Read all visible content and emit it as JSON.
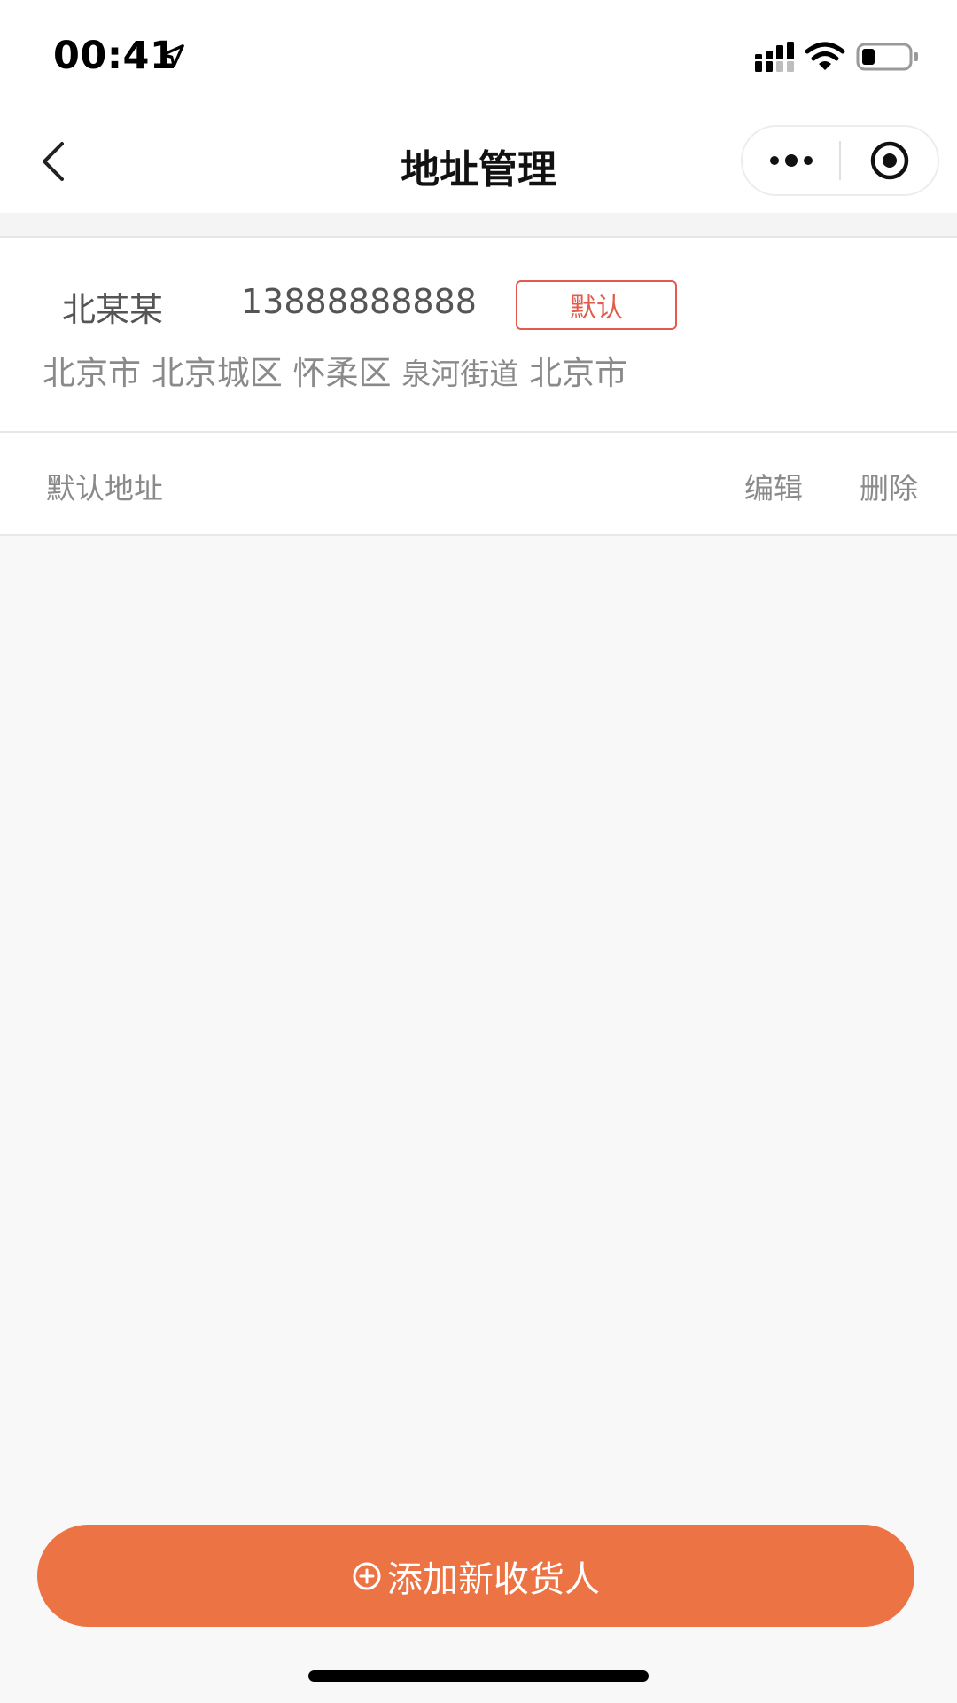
{
  "status_bar": {
    "time": "00:41"
  },
  "nav": {
    "title": "地址管理"
  },
  "address": {
    "name": "北某某",
    "phone": "13888888888",
    "badge": "默认",
    "province": "北京市",
    "city": "北京城区",
    "district": "怀柔区",
    "street": "泉河街道",
    "detail": "北京市",
    "default_label": "默认地址",
    "edit_label": "编辑",
    "delete_label": "删除"
  },
  "footer": {
    "add_label": "添加新收货人"
  },
  "colors": {
    "accent": "#ec7444",
    "badge": "#e25b4b",
    "text_secondary": "#8a8a8a"
  }
}
